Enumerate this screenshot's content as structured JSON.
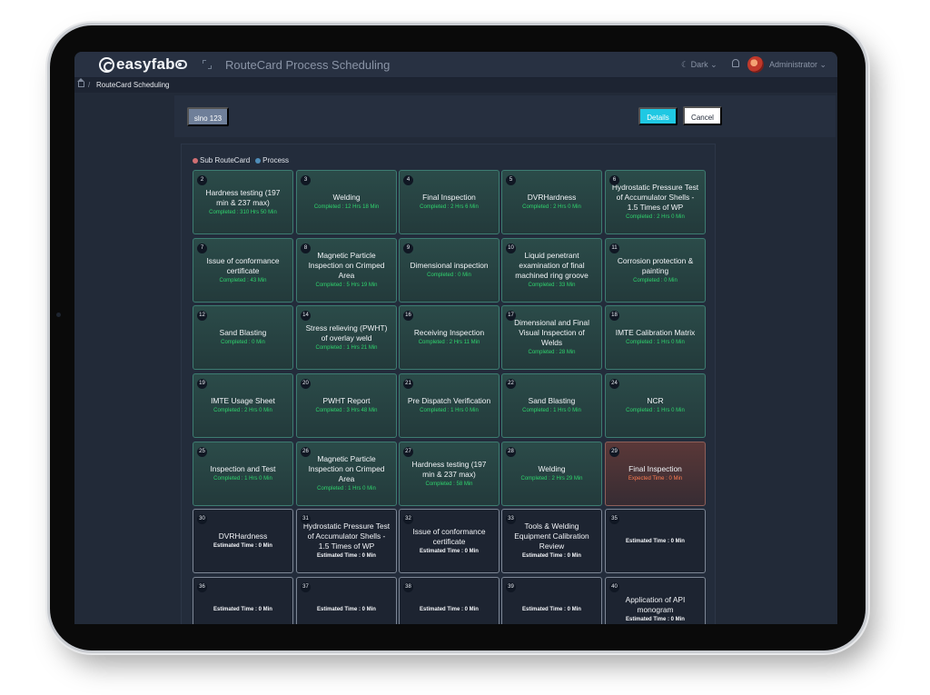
{
  "app": {
    "logo_text": "easyfab",
    "page_title": "RouteCard Process Scheduling",
    "theme_label": "☾ Dark ⌄",
    "user_name": "Administrator ⌄"
  },
  "breadcrumb": {
    "separator": "/",
    "current": "RouteCard Scheduling"
  },
  "actions": {
    "slno_label": "slno 123",
    "details_label": "Details",
    "cancel_label": "Cancel"
  },
  "legend": {
    "sub_routecard_label": "Sub RouteCard",
    "process_label": "Process",
    "sub_routecard_color": "#d16f73",
    "process_color": "#4f8db9"
  },
  "cards": [
    {
      "num": "2",
      "title": "Hardness testing (197 min & 237 max)",
      "status": "Completed : 310 Hrs 50 Min",
      "state": "completed"
    },
    {
      "num": "3",
      "title": "Welding",
      "status": "Completed : 12 Hrs 18 Min",
      "state": "completed"
    },
    {
      "num": "4",
      "title": "Final Inspection",
      "status": "Completed : 2 Hrs 6 Min",
      "state": "completed"
    },
    {
      "num": "5",
      "title": "DVRHardness",
      "status": "Completed : 2 Hrs 0 Min",
      "state": "completed"
    },
    {
      "num": "6",
      "title": "Hydrostatic Pressure Test of Accumulator Shells - 1.5 Times of WP",
      "status": "Completed : 2 Hrs 0 Min",
      "state": "completed"
    },
    {
      "num": "7",
      "title": "Issue of conformance certificate",
      "status": "Completed : 43 Min",
      "state": "completed"
    },
    {
      "num": "8",
      "title": "Magnetic Particle Inspection on Crimped Area",
      "status": "Completed : 5 Hrs 19 Min",
      "state": "completed"
    },
    {
      "num": "9",
      "title": "Dimensional inspection",
      "status": "Completed : 0 Min",
      "state": "completed"
    },
    {
      "num": "10",
      "title": "Liquid penetrant examination of final machined ring groove",
      "status": "Completed : 33 Min",
      "state": "completed"
    },
    {
      "num": "11",
      "title": "Corrosion protection & painting",
      "status": "Completed : 0 Min",
      "state": "completed"
    },
    {
      "num": "12",
      "title": "Sand Blasting",
      "status": "Completed : 0 Min",
      "state": "completed"
    },
    {
      "num": "14",
      "title": "Stress relieving (PWHT) of overlay weld",
      "status": "Completed : 1 Hrs 21 Min",
      "state": "completed"
    },
    {
      "num": "16",
      "title": "Receiving Inspection",
      "status": "Completed : 2 Hrs 11 Min",
      "state": "completed"
    },
    {
      "num": "17",
      "title": "Dimensional and Final Visual Inspection of Welds",
      "status": "Completed : 28 Min",
      "state": "completed"
    },
    {
      "num": "18",
      "title": "IMTE Calibration Matrix",
      "status": "Completed : 1 Hrs 0 Min",
      "state": "completed"
    },
    {
      "num": "19",
      "title": "IMTE Usage Sheet",
      "status": "Completed : 2 Hrs 0 Min",
      "state": "completed"
    },
    {
      "num": "20",
      "title": "PWHT Report",
      "status": "Completed : 3 Hrs 48 Min",
      "state": "completed"
    },
    {
      "num": "21",
      "title": "Pre Dispatch Verification",
      "status": "Completed : 1 Hrs 0 Min",
      "state": "completed"
    },
    {
      "num": "22",
      "title": "Sand Blasting",
      "status": "Completed : 1 Hrs 0 Min",
      "state": "completed"
    },
    {
      "num": "24",
      "title": "NCR",
      "status": "Completed : 1 Hrs 0 Min",
      "state": "completed"
    },
    {
      "num": "25",
      "title": "Inspection and Test",
      "status": "Completed : 1 Hrs 0 Min",
      "state": "completed"
    },
    {
      "num": "26",
      "title": "Magnetic Particle Inspection on Crimped Area",
      "status": "Completed : 1 Hrs 0 Min",
      "state": "completed"
    },
    {
      "num": "27",
      "title": "Hardness testing (197 min & 237 max)",
      "status": "Completed : 58 Min",
      "state": "completed"
    },
    {
      "num": "28",
      "title": "Welding",
      "status": "Completed : 2 Hrs 29 Min",
      "state": "completed"
    },
    {
      "num": "29",
      "title": "Final Inspection",
      "status": "Expected Time : 0 Min",
      "state": "active"
    },
    {
      "num": "30",
      "title": "DVRHardness",
      "status": "Estimated Time : 0 Min",
      "state": "pending"
    },
    {
      "num": "31",
      "title": "Hydrostatic Pressure Test of Accumulator Shells - 1.5 Times of WP",
      "status": "Estimated Time : 0 Min",
      "state": "pending"
    },
    {
      "num": "32",
      "title": "Issue of conformance certificate",
      "status": "Estimated Time : 0 Min",
      "state": "pending"
    },
    {
      "num": "33",
      "title": "Tools & Welding Equipment Calibration Review",
      "status": "Estimated Time : 0 Min",
      "state": "pending"
    },
    {
      "num": "35",
      "title": "",
      "status": "Estimated Time : 0 Min",
      "state": "pending"
    },
    {
      "num": "36",
      "title": "",
      "status": "Estimated Time : 0 Min",
      "state": "pending"
    },
    {
      "num": "37",
      "title": "",
      "status": "Estimated Time : 0 Min",
      "state": "pending"
    },
    {
      "num": "38",
      "title": "",
      "status": "Estimated Time : 0 Min",
      "state": "pending"
    },
    {
      "num": "39",
      "title": "",
      "status": "Estimated Time : 0 Min",
      "state": "pending"
    },
    {
      "num": "40",
      "title": "Application of API monogram",
      "status": "Estimated Time : 0 Min",
      "state": "pending"
    }
  ]
}
